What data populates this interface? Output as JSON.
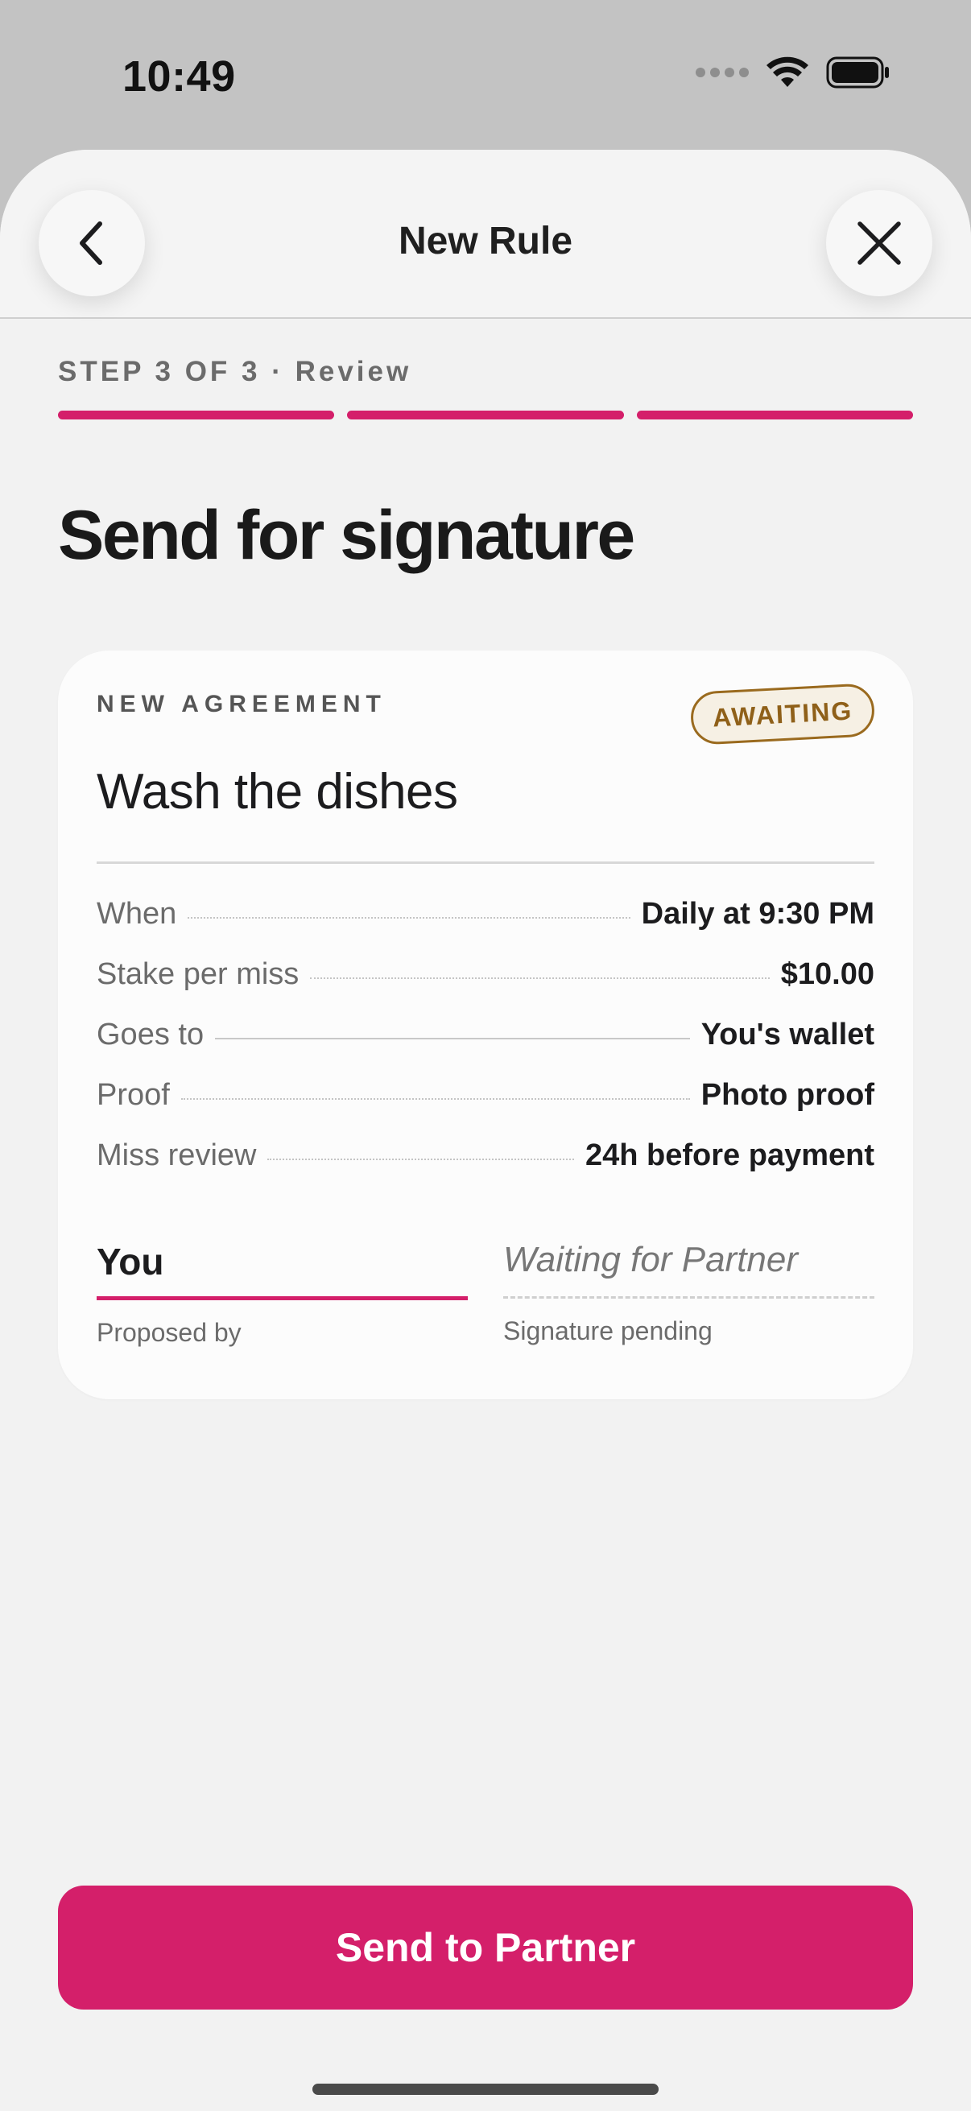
{
  "status_bar": {
    "time": "10:49"
  },
  "header": {
    "title": "New Rule",
    "back_icon": "chevron-left-icon",
    "close_icon": "close-icon"
  },
  "step": {
    "label": "STEP 3 OF 3 · Review",
    "current": 3,
    "total": 3
  },
  "heading": "Send for signature",
  "agreement": {
    "eyebrow": "NEW AGREEMENT",
    "status_badge": "AWAITING",
    "title": "Wash the dishes",
    "details": [
      {
        "label": "When",
        "value": "Daily at 9:30 PM"
      },
      {
        "label": "Stake per miss",
        "value": "$10.00"
      },
      {
        "label": "Goes to",
        "value": "You's wallet"
      },
      {
        "label": "Proof",
        "value": "Photo proof"
      },
      {
        "label": "Miss review",
        "value": "24h before payment"
      }
    ],
    "proposer": {
      "name": "You",
      "caption": "Proposed by"
    },
    "signer": {
      "name": "Waiting for Partner",
      "caption": "Signature pending"
    }
  },
  "primary_action": {
    "label": "Send to Partner"
  },
  "colors": {
    "accent": "#d41f6a",
    "badge": "#9a6a1e",
    "background": "#f2f2f2",
    "card": "#fcfcfc"
  }
}
